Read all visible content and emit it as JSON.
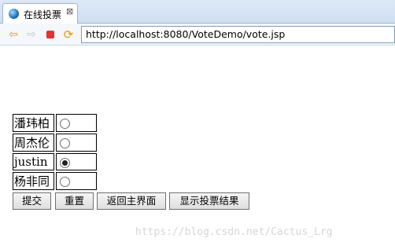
{
  "tab": {
    "title": "在线投票",
    "icon": "globe-icon",
    "close_label": "⊠"
  },
  "navigation": {
    "back_icon": "back-arrow-icon",
    "forward_icon": "forward-arrow-icon",
    "stop_icon": "stop-icon",
    "refresh_icon": "refresh-icon",
    "url": "http://localhost:8080/VoteDemo/vote.jsp"
  },
  "vote": {
    "candidates": [
      {
        "name": "潘玮柏",
        "selected": false
      },
      {
        "name": "周杰伦",
        "selected": false
      },
      {
        "name": "justin",
        "selected": true
      },
      {
        "name": "杨非同",
        "selected": false
      }
    ]
  },
  "buttons": {
    "submit": "提交",
    "reset": "重置",
    "back_main": "返回主界面",
    "show_results": "显示投票结果"
  },
  "watermark": "https://blog.csdn.net/Cactus_Lrg"
}
